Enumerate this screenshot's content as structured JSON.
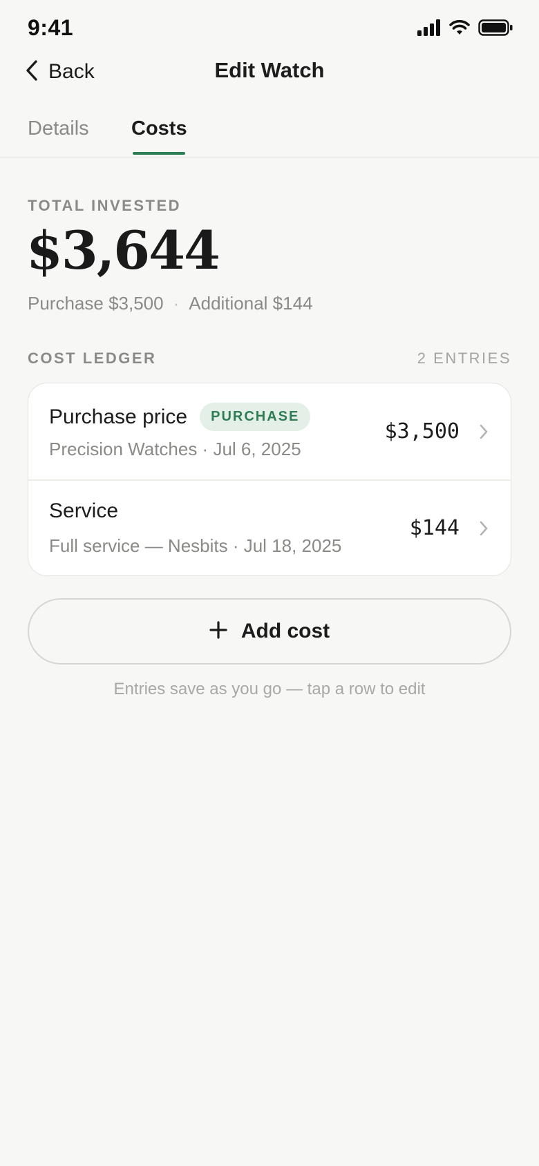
{
  "status_bar": {
    "time": "9:41"
  },
  "nav": {
    "back_label": "Back",
    "title": "Edit Watch"
  },
  "tabs": [
    {
      "label": "Details",
      "active": false
    },
    {
      "label": "Costs",
      "active": true
    }
  ],
  "total": {
    "label": "TOTAL INVESTED",
    "amount": "$3,644",
    "purchase_text": "Purchase $3,500",
    "separator": "·",
    "additional_text": "Additional $144"
  },
  "ledger": {
    "heading": "COST LEDGER",
    "count": "2 ENTRIES",
    "entries": [
      {
        "title": "Purchase price",
        "badge": "PURCHASE",
        "subtitle": "Precision Watches · Jul 6, 2025",
        "amount": "$3,500"
      },
      {
        "title": "Service",
        "subtitle": "Full service — Nesbits · Jul 18, 2025",
        "amount": "$144"
      }
    ]
  },
  "actions": {
    "add_cost_label": "Add cost",
    "hint": "Entries save as you go — tap a row to edit"
  },
  "colors": {
    "accent": "#2e7d55",
    "badge_bg": "#e3efe7",
    "background": "#f7f7f5",
    "card": "#ffffff",
    "muted_text": "#8a8a86"
  },
  "icons": [
    "signal-icon",
    "wifi-icon",
    "battery-icon",
    "chevron-left-icon",
    "chevron-right-icon",
    "plus-icon"
  ]
}
